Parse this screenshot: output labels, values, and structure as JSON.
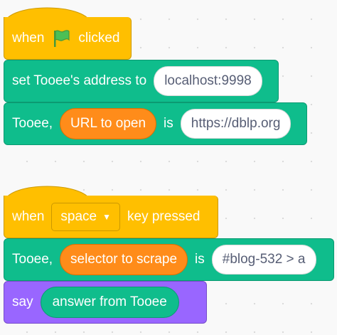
{
  "script1": {
    "hat": {
      "when": "when",
      "clicked": "clicked",
      "flag_icon": "green-flag-icon"
    },
    "set_address": {
      "label": "set Tooee's address to",
      "value": "localhost:9998"
    },
    "open_url": {
      "prefix": "Tooee,",
      "reporter": "URL to open",
      "is": "is",
      "value": "https://dblp.org"
    }
  },
  "script2": {
    "hat": {
      "when": "when",
      "key": "space",
      "pressed": "key pressed"
    },
    "scrape": {
      "prefix": "Tooee,",
      "reporter": "selector to scrape",
      "is": "is",
      "value": "#blog-532 > a"
    },
    "say": {
      "label": "say",
      "reporter": "answer from Tooee"
    }
  },
  "colors": {
    "events": "#ffbf00",
    "extension": "#0fbd8c",
    "looks": "#9966ff",
    "reporter": "#ff8c1a",
    "background": "#f9f9f9"
  }
}
